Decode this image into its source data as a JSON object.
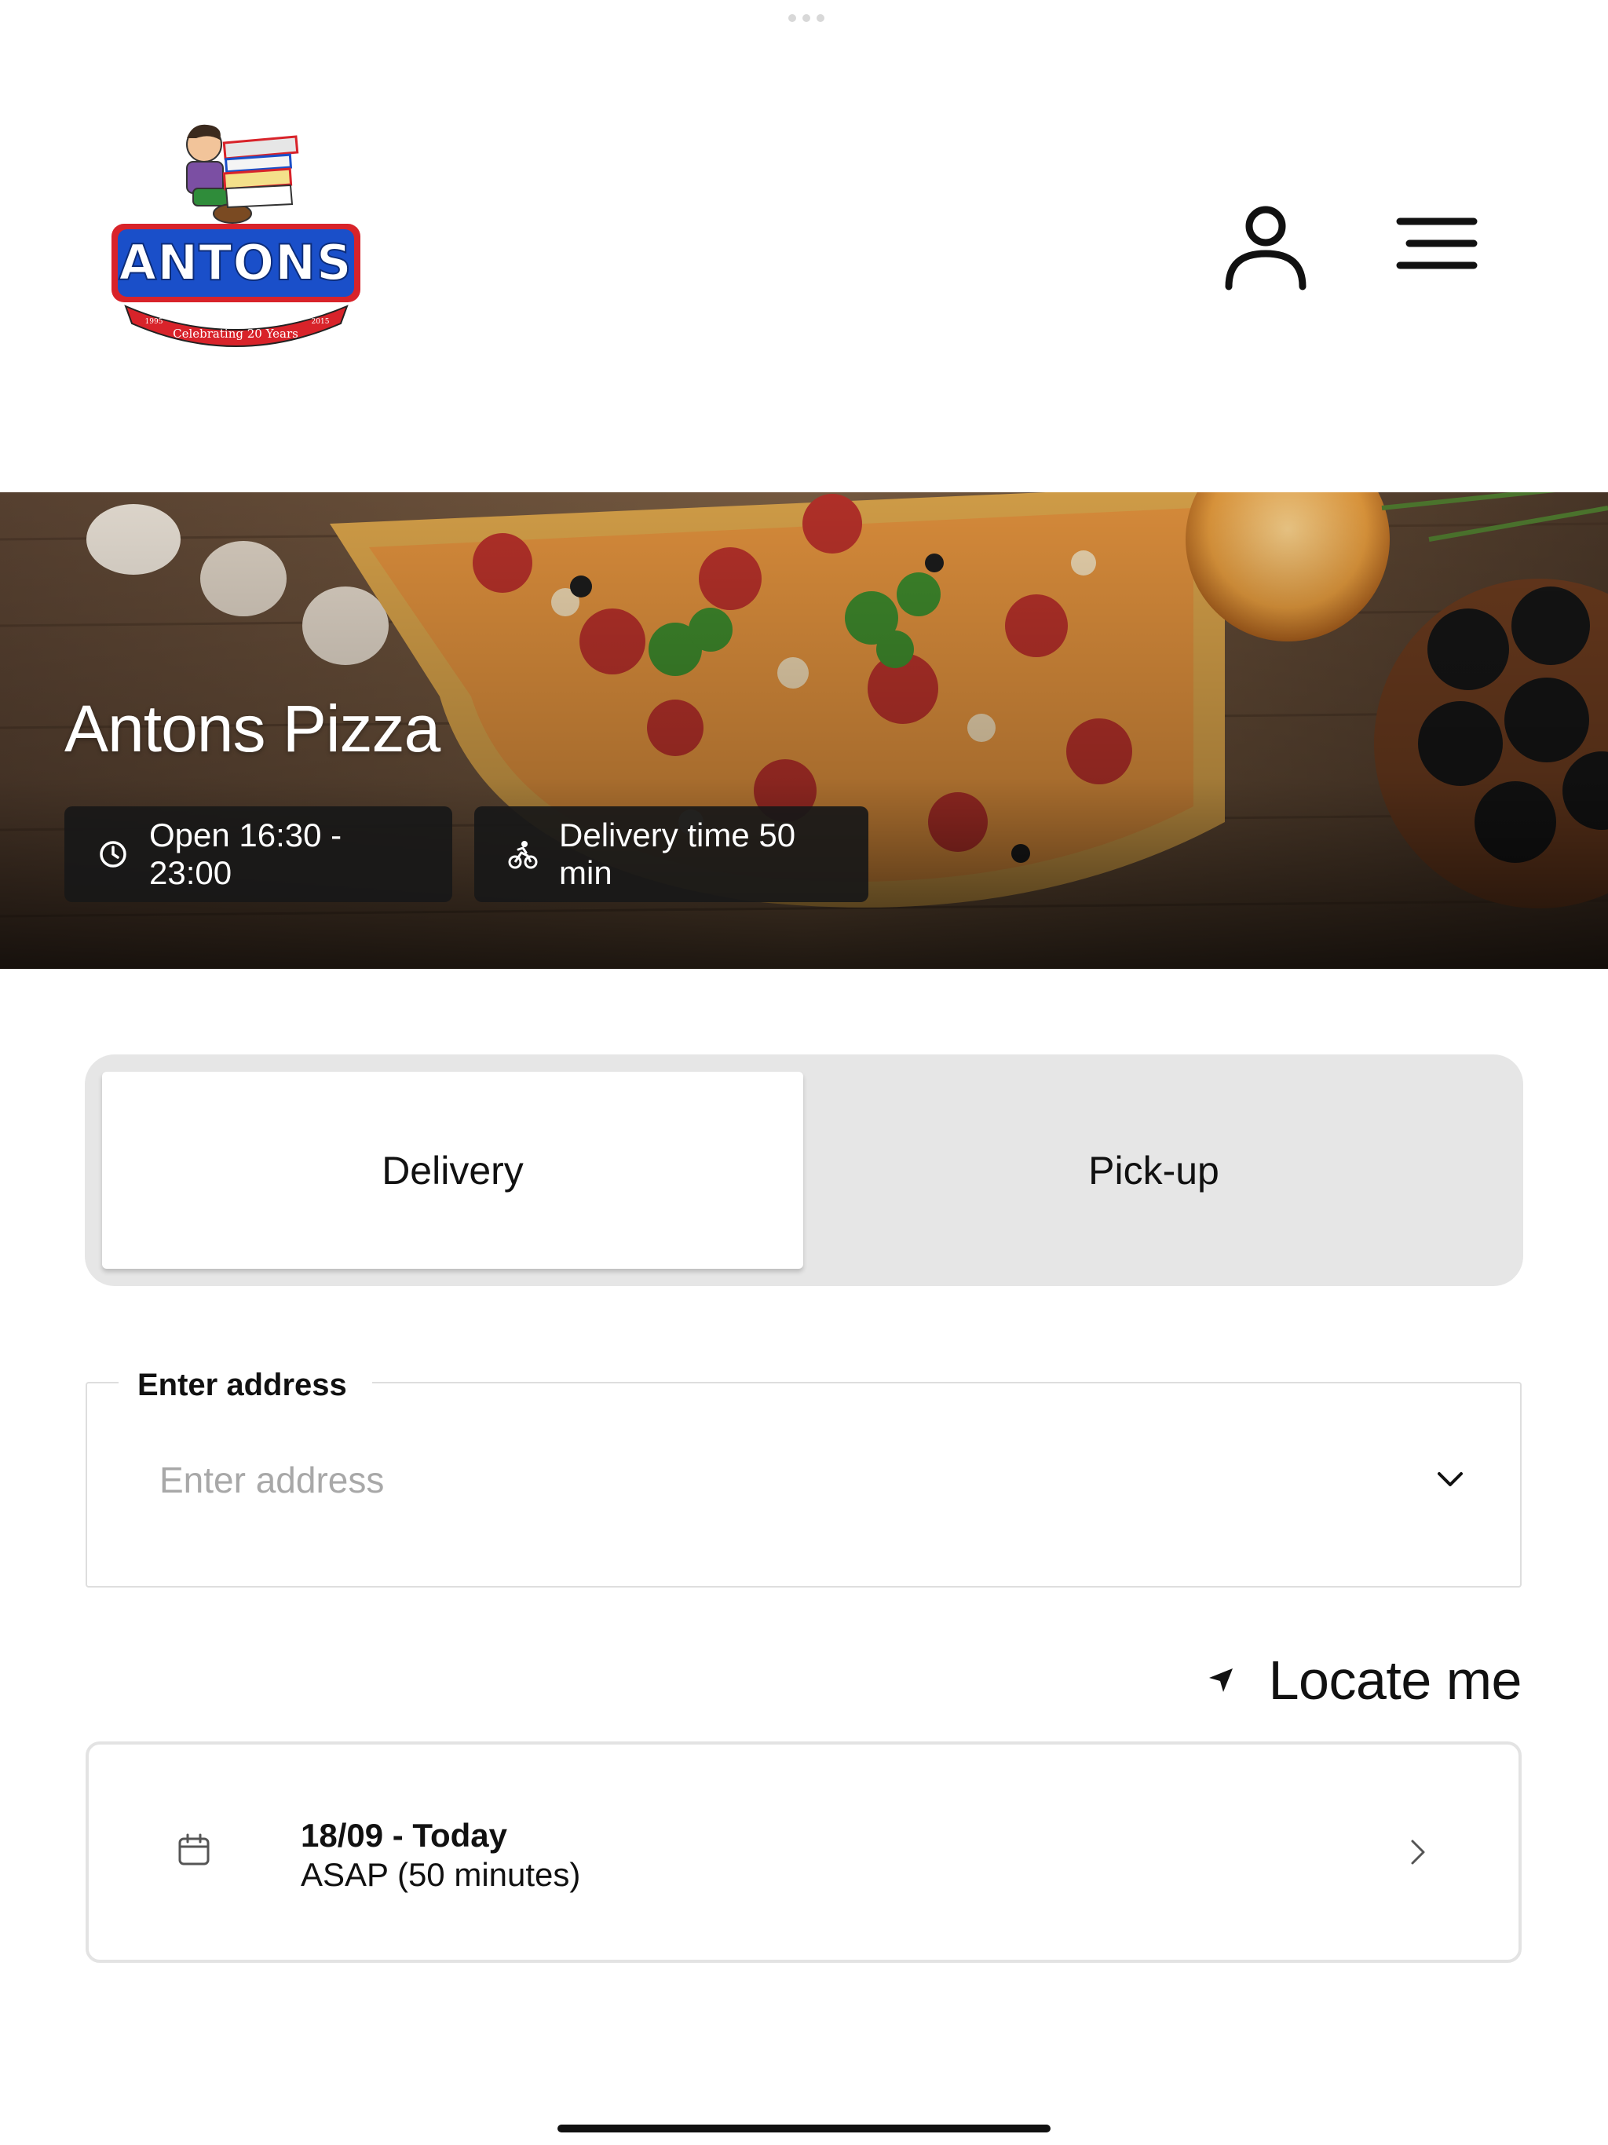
{
  "brand": {
    "logo_wordmark": "ANTONS",
    "logo_banner": "Celebrating 20 Years",
    "logo_year_left": "1995",
    "logo_year_right": "2015"
  },
  "header": {
    "account_icon": "user-icon",
    "menu_icon": "hamburger-menu-icon"
  },
  "hero": {
    "title": "Antons Pizza",
    "open_hours": "Open 16:30 - 23:00",
    "open_icon": "clock-icon",
    "delivery_time": "Delivery time 50 min",
    "delivery_icon": "bicycle-icon"
  },
  "order_type": {
    "options": [
      "Delivery",
      "Pick-up"
    ],
    "selected": "Delivery"
  },
  "address": {
    "label": "Enter address",
    "placeholder": "Enter address",
    "value": ""
  },
  "locate": {
    "label": "Locate me",
    "icon": "location-arrow-icon"
  },
  "schedule": {
    "date": "18/09 - Today",
    "time": "ASAP (50 minutes)",
    "icon": "calendar-icon"
  },
  "colors": {
    "logo_blue": "#1a4fc9",
    "logo_red": "#d8232a",
    "chip_bg": "#181818",
    "toggle_bg": "#e6e6e6"
  }
}
